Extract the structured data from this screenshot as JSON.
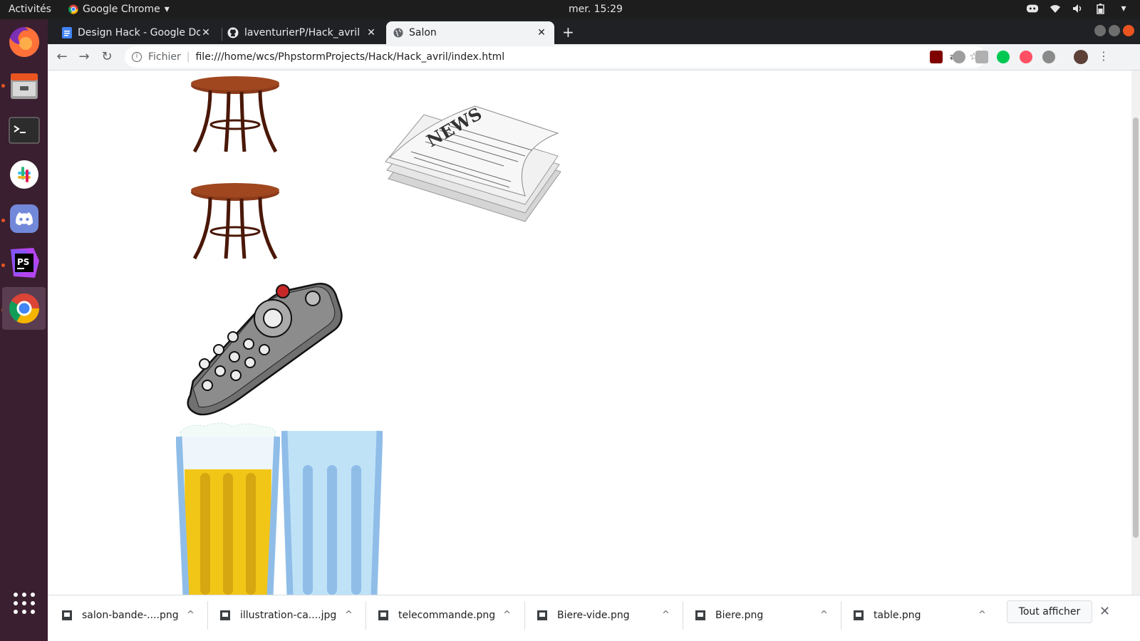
{
  "system_bar": {
    "activities": "Activités",
    "app_name": "Google Chrome",
    "clock": "mer. 15:29",
    "tray_icons": [
      "discord-icon",
      "wifi-icon",
      "volume-icon",
      "battery-icon"
    ]
  },
  "dock": {
    "items": [
      "firefox-icon",
      "files-icon",
      "terminal-icon",
      "slack-icon",
      "discord-icon",
      "phpstorm-icon",
      "chrome-icon",
      "apps-grid-icon"
    ],
    "active": "chrome-icon"
  },
  "browser": {
    "tabs": [
      {
        "label": "Design Hack - Google Docs",
        "icon": "docs-icon"
      },
      {
        "label": "laventurierP/Hack_avril",
        "icon": "github-icon"
      },
      {
        "label": "Salon",
        "icon": "globe-icon",
        "active": true
      }
    ],
    "address": {
      "scheme_label": "Fichier",
      "url": "file:///home/wcs/PhpstormProjects/Hack/Hack_avril/index.html"
    }
  },
  "page": {
    "images": [
      "table-image",
      "table-image",
      "newspaper-image",
      "remote-control-image",
      "beer-glass-image",
      "empty-glass-image"
    ],
    "newspaper_text": "NEWS"
  },
  "downloads": {
    "items": [
      {
        "name": "salon-bande-....png"
      },
      {
        "name": "illustration-ca....jpg"
      },
      {
        "name": "telecommande.png"
      },
      {
        "name": "Biere-vide.png"
      },
      {
        "name": "Biere.png"
      },
      {
        "name": "table.png"
      }
    ],
    "show_all": "Tout afficher"
  }
}
